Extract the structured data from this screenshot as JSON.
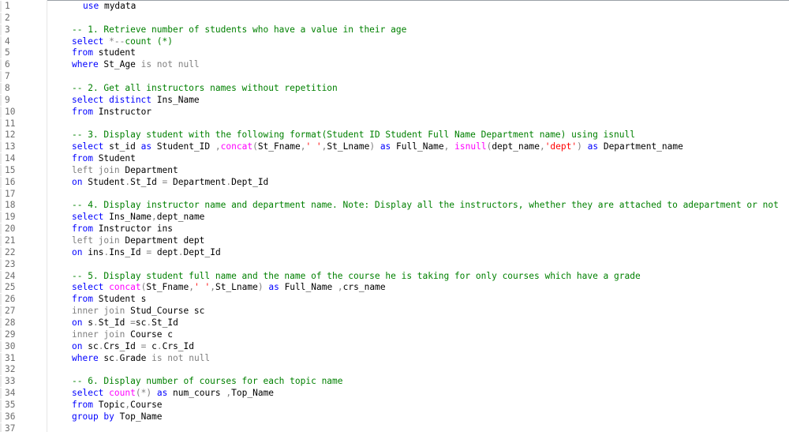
{
  "editor": {
    "colors": {
      "keyword": "#0000ff",
      "comment": "#008000",
      "operator": "#808080",
      "function": "#ff00ff",
      "string": "#ff0000",
      "identifier": "#000000",
      "line_number": "#6e6e6e"
    },
    "lines": [
      {
        "n": "1",
        "indent": 1,
        "tokens": [
          {
            "t": "use",
            "c": "kw"
          },
          {
            "t": " mydata",
            "c": "id"
          }
        ]
      },
      {
        "n": "2",
        "indent": 0,
        "tokens": []
      },
      {
        "n": "3",
        "indent": 0,
        "tokens": [
          {
            "t": "-- 1. Retrieve number of students who have a value in their age",
            "c": "cm"
          }
        ]
      },
      {
        "n": "4",
        "indent": 0,
        "tokens": [
          {
            "t": "select",
            "c": "kw"
          },
          {
            "t": " ",
            "c": "id"
          },
          {
            "t": "*--",
            "c": "gray"
          },
          {
            "t": "count (*)",
            "c": "cm"
          }
        ]
      },
      {
        "n": "5",
        "indent": 0,
        "tokens": [
          {
            "t": "from",
            "c": "kw"
          },
          {
            "t": " student",
            "c": "id"
          }
        ]
      },
      {
        "n": "6",
        "indent": 0,
        "tokens": [
          {
            "t": "where",
            "c": "kw"
          },
          {
            "t": " St_Age ",
            "c": "id"
          },
          {
            "t": "is not null",
            "c": "gray"
          }
        ]
      },
      {
        "n": "7",
        "indent": 0,
        "tokens": []
      },
      {
        "n": "8",
        "indent": 0,
        "tokens": [
          {
            "t": "-- 2. Get all instructors names without repetition",
            "c": "cm"
          }
        ]
      },
      {
        "n": "9",
        "indent": 0,
        "tokens": [
          {
            "t": "select distinct",
            "c": "kw"
          },
          {
            "t": " Ins_Name",
            "c": "id"
          }
        ]
      },
      {
        "n": "10",
        "indent": 0,
        "tokens": [
          {
            "t": "from",
            "c": "kw"
          },
          {
            "t": " Instructor",
            "c": "id"
          }
        ]
      },
      {
        "n": "11",
        "indent": 0,
        "tokens": []
      },
      {
        "n": "12",
        "indent": 0,
        "tokens": [
          {
            "t": "-- 3. Display student with the following format(Student ID Student Full Name Department name) using isnull",
            "c": "cm"
          }
        ]
      },
      {
        "n": "13",
        "indent": 0,
        "tokens": [
          {
            "t": "select",
            "c": "kw"
          },
          {
            "t": " st_id ",
            "c": "id"
          },
          {
            "t": "as",
            "c": "kw"
          },
          {
            "t": " Student_ID ",
            "c": "id"
          },
          {
            "t": ",",
            "c": "gray"
          },
          {
            "t": "concat",
            "c": "fn"
          },
          {
            "t": "(",
            "c": "gray"
          },
          {
            "t": "St_Fname",
            "c": "id"
          },
          {
            "t": ",",
            "c": "gray"
          },
          {
            "t": "' '",
            "c": "str"
          },
          {
            "t": ",",
            "c": "gray"
          },
          {
            "t": "St_Lname",
            "c": "id"
          },
          {
            "t": ")",
            "c": "gray"
          },
          {
            "t": " ",
            "c": "id"
          },
          {
            "t": "as",
            "c": "kw"
          },
          {
            "t": " Full_Name",
            "c": "id"
          },
          {
            "t": ", ",
            "c": "gray"
          },
          {
            "t": "isnull",
            "c": "fn"
          },
          {
            "t": "(",
            "c": "gray"
          },
          {
            "t": "dept_name",
            "c": "id"
          },
          {
            "t": ",",
            "c": "gray"
          },
          {
            "t": "'dept'",
            "c": "str"
          },
          {
            "t": ")",
            "c": "gray"
          },
          {
            "t": " ",
            "c": "id"
          },
          {
            "t": "as",
            "c": "kw"
          },
          {
            "t": " Department_name",
            "c": "id"
          }
        ]
      },
      {
        "n": "14",
        "indent": 0,
        "tokens": [
          {
            "t": "from",
            "c": "kw"
          },
          {
            "t": " Student",
            "c": "id"
          }
        ]
      },
      {
        "n": "15",
        "indent": 0,
        "tokens": [
          {
            "t": "left join",
            "c": "gray"
          },
          {
            "t": " Department",
            "c": "id"
          }
        ]
      },
      {
        "n": "16",
        "indent": 0,
        "tokens": [
          {
            "t": "on",
            "c": "kw"
          },
          {
            "t": " Student",
            "c": "id"
          },
          {
            "t": ".",
            "c": "gray"
          },
          {
            "t": "St_Id ",
            "c": "id"
          },
          {
            "t": "=",
            "c": "gray"
          },
          {
            "t": " Department",
            "c": "id"
          },
          {
            "t": ".",
            "c": "gray"
          },
          {
            "t": "Dept_Id",
            "c": "id"
          }
        ]
      },
      {
        "n": "17",
        "indent": 0,
        "tokens": []
      },
      {
        "n": "18",
        "indent": 0,
        "tokens": [
          {
            "t": "-- 4. Display instructor name and department name. Note: Display all the instructors, whether they are attached to adepartment or not",
            "c": "cm"
          }
        ]
      },
      {
        "n": "19",
        "indent": 0,
        "tokens": [
          {
            "t": "select",
            "c": "kw"
          },
          {
            "t": " Ins_Name",
            "c": "id"
          },
          {
            "t": ",",
            "c": "gray"
          },
          {
            "t": "dept_name",
            "c": "id"
          }
        ]
      },
      {
        "n": "20",
        "indent": 0,
        "tokens": [
          {
            "t": "from",
            "c": "kw"
          },
          {
            "t": " Instructor ins",
            "c": "id"
          }
        ]
      },
      {
        "n": "21",
        "indent": 0,
        "tokens": [
          {
            "t": "left join",
            "c": "gray"
          },
          {
            "t": " Department dept",
            "c": "id"
          }
        ]
      },
      {
        "n": "22",
        "indent": 0,
        "tokens": [
          {
            "t": "on",
            "c": "kw"
          },
          {
            "t": " ins",
            "c": "id"
          },
          {
            "t": ".",
            "c": "gray"
          },
          {
            "t": "Ins_Id ",
            "c": "id"
          },
          {
            "t": "=",
            "c": "gray"
          },
          {
            "t": " dept",
            "c": "id"
          },
          {
            "t": ".",
            "c": "gray"
          },
          {
            "t": "Dept_Id",
            "c": "id"
          }
        ]
      },
      {
        "n": "23",
        "indent": 0,
        "tokens": []
      },
      {
        "n": "24",
        "indent": 0,
        "tokens": [
          {
            "t": "-- 5. Display student full name and the name of the course he is taking for only courses which have a grade",
            "c": "cm"
          }
        ]
      },
      {
        "n": "25",
        "indent": 0,
        "tokens": [
          {
            "t": "select",
            "c": "kw"
          },
          {
            "t": " ",
            "c": "id"
          },
          {
            "t": "concat",
            "c": "fn"
          },
          {
            "t": "(",
            "c": "gray"
          },
          {
            "t": "St_Fname",
            "c": "id"
          },
          {
            "t": ",",
            "c": "gray"
          },
          {
            "t": "' '",
            "c": "str"
          },
          {
            "t": ",",
            "c": "gray"
          },
          {
            "t": "St_Lname",
            "c": "id"
          },
          {
            "t": ")",
            "c": "gray"
          },
          {
            "t": " ",
            "c": "id"
          },
          {
            "t": "as",
            "c": "kw"
          },
          {
            "t": " Full_Name ",
            "c": "id"
          },
          {
            "t": ",",
            "c": "gray"
          },
          {
            "t": "crs_name",
            "c": "id"
          }
        ]
      },
      {
        "n": "26",
        "indent": 0,
        "tokens": [
          {
            "t": "from",
            "c": "kw"
          },
          {
            "t": " Student s",
            "c": "id"
          }
        ]
      },
      {
        "n": "27",
        "indent": 0,
        "tokens": [
          {
            "t": "inner join",
            "c": "gray"
          },
          {
            "t": " Stud_Course sc",
            "c": "id"
          }
        ]
      },
      {
        "n": "28",
        "indent": 0,
        "tokens": [
          {
            "t": "on",
            "c": "kw"
          },
          {
            "t": " s",
            "c": "id"
          },
          {
            "t": ".",
            "c": "gray"
          },
          {
            "t": "St_Id ",
            "c": "id"
          },
          {
            "t": "=",
            "c": "gray"
          },
          {
            "t": "sc",
            "c": "id"
          },
          {
            "t": ".",
            "c": "gray"
          },
          {
            "t": "St_Id",
            "c": "id"
          }
        ]
      },
      {
        "n": "29",
        "indent": 0,
        "tokens": [
          {
            "t": "inner join",
            "c": "gray"
          },
          {
            "t": " Course c",
            "c": "id"
          }
        ]
      },
      {
        "n": "30",
        "indent": 0,
        "tokens": [
          {
            "t": "on",
            "c": "kw"
          },
          {
            "t": " sc",
            "c": "id"
          },
          {
            "t": ".",
            "c": "gray"
          },
          {
            "t": "Crs_Id ",
            "c": "id"
          },
          {
            "t": "=",
            "c": "gray"
          },
          {
            "t": " c",
            "c": "id"
          },
          {
            "t": ".",
            "c": "gray"
          },
          {
            "t": "Crs_Id",
            "c": "id"
          }
        ]
      },
      {
        "n": "31",
        "indent": 0,
        "tokens": [
          {
            "t": "where",
            "c": "kw"
          },
          {
            "t": " sc",
            "c": "id"
          },
          {
            "t": ".",
            "c": "gray"
          },
          {
            "t": "Grade ",
            "c": "id"
          },
          {
            "t": "is not null",
            "c": "gray"
          }
        ]
      },
      {
        "n": "32",
        "indent": 0,
        "tokens": []
      },
      {
        "n": "33",
        "indent": 0,
        "tokens": [
          {
            "t": "-- 6. Display number of courses for each topic name",
            "c": "cm"
          }
        ]
      },
      {
        "n": "34",
        "indent": 0,
        "tokens": [
          {
            "t": "select",
            "c": "kw"
          },
          {
            "t": " ",
            "c": "id"
          },
          {
            "t": "count",
            "c": "fn"
          },
          {
            "t": "(*)",
            "c": "gray"
          },
          {
            "t": " ",
            "c": "id"
          },
          {
            "t": "as",
            "c": "kw"
          },
          {
            "t": " num_cours ",
            "c": "id"
          },
          {
            "t": ",",
            "c": "gray"
          },
          {
            "t": "Top_Name",
            "c": "id"
          }
        ]
      },
      {
        "n": "35",
        "indent": 0,
        "tokens": [
          {
            "t": "from",
            "c": "kw"
          },
          {
            "t": " Topic",
            "c": "id"
          },
          {
            "t": ",",
            "c": "gray"
          },
          {
            "t": "Course",
            "c": "id"
          }
        ]
      },
      {
        "n": "36",
        "indent": 0,
        "tokens": [
          {
            "t": "group by",
            "c": "kw"
          },
          {
            "t": " Top_Name",
            "c": "id"
          }
        ]
      },
      {
        "n": "37",
        "indent": 0,
        "tokens": []
      }
    ]
  }
}
